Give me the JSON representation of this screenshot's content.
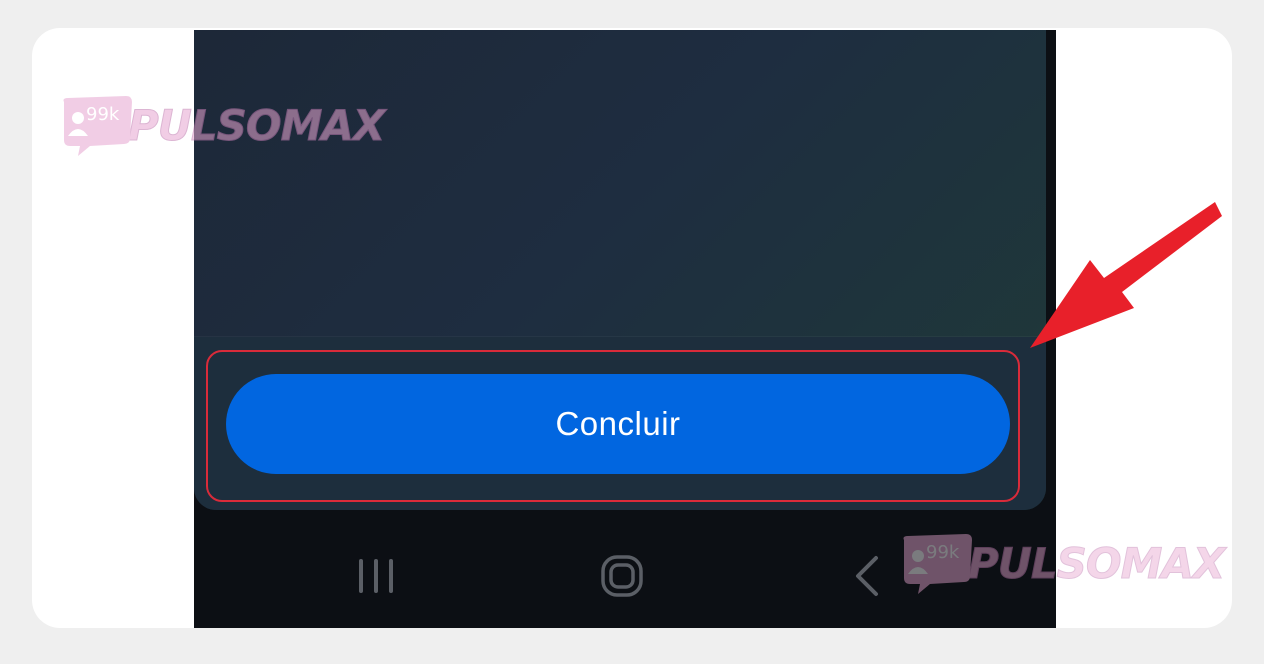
{
  "dialog": {
    "primary_button_label": "Concluir"
  },
  "navigation_bar": {
    "buttons": [
      {
        "name": "recents",
        "icon": "recents-icon"
      },
      {
        "name": "home",
        "icon": "home-icon"
      },
      {
        "name": "back",
        "icon": "back-icon"
      }
    ]
  },
  "watermark": {
    "badge_count": "99k",
    "brand": "PULSOMAX"
  },
  "colors": {
    "button": "#0166e0",
    "highlight": "#d92b3a",
    "arrow": "#e8202a",
    "screen_bg_start": "#1d2838",
    "screen_bg_end": "#1f3a38",
    "nav_bg": "#0c0f14"
  }
}
